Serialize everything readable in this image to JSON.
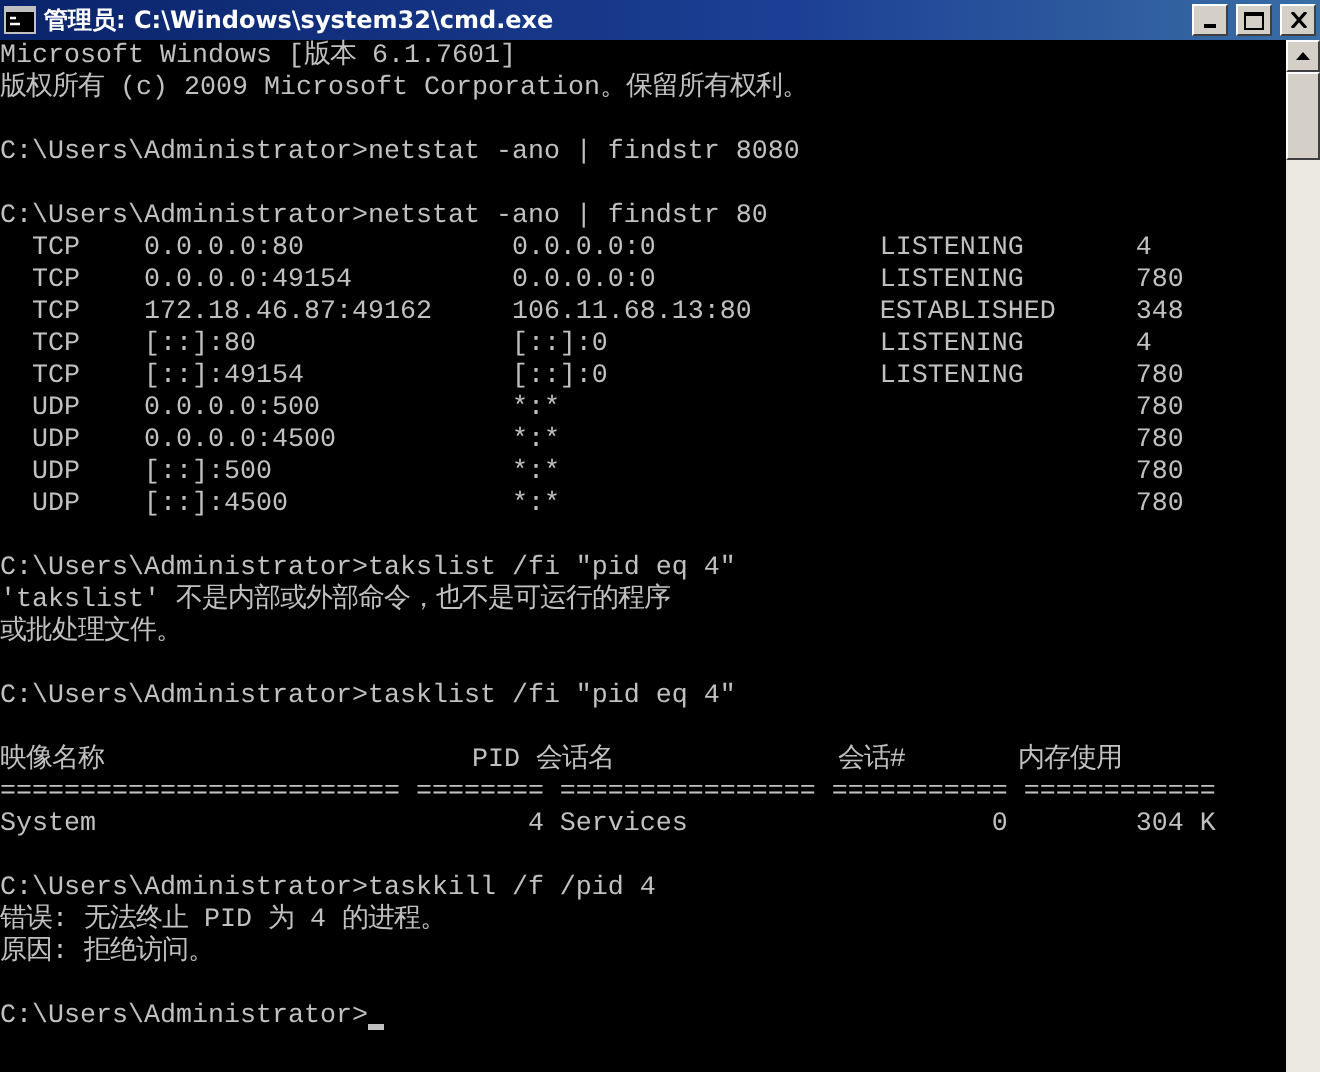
{
  "window": {
    "title": "管理员: C:\\Windows\\system32\\cmd.exe"
  },
  "console": {
    "cursor": true,
    "lines": [
      {
        "kind": "output",
        "text": "Microsoft Windows [版本 6.1.7601]"
      },
      {
        "kind": "output",
        "text": "版权所有 (c) 2009 Microsoft Corporation。保留所有权利。"
      },
      {
        "kind": "blank"
      },
      {
        "kind": "command",
        "text": "C:\\Users\\Administrator>netstat -ano | findstr 8080"
      },
      {
        "kind": "blank"
      },
      {
        "kind": "command",
        "text": "C:\\Users\\Administrator>netstat -ano | findstr 80"
      },
      {
        "kind": "output",
        "text": "  TCP    0.0.0.0:80             0.0.0.0:0              LISTENING       4"
      },
      {
        "kind": "output",
        "text": "  TCP    0.0.0.0:49154          0.0.0.0:0              LISTENING       780"
      },
      {
        "kind": "output",
        "text": "  TCP    172.18.46.87:49162     106.11.68.13:80        ESTABLISHED     348"
      },
      {
        "kind": "output",
        "text": "  TCP    [::]:80                [::]:0                 LISTENING       4"
      },
      {
        "kind": "output",
        "text": "  TCP    [::]:49154             [::]:0                 LISTENING       780"
      },
      {
        "kind": "output",
        "text": "  UDP    0.0.0.0:500            *:*                                    780"
      },
      {
        "kind": "output",
        "text": "  UDP    0.0.0.0:4500           *:*                                    780"
      },
      {
        "kind": "output",
        "text": "  UDP    [::]:500               *:*                                    780"
      },
      {
        "kind": "output",
        "text": "  UDP    [::]:4500              *:*                                    780"
      },
      {
        "kind": "blank"
      },
      {
        "kind": "command",
        "text": "C:\\Users\\Administrator>takslist /fi \"pid eq 4\""
      },
      {
        "kind": "output",
        "text": "'takslist' 不是内部或外部命令，也不是可运行的程序"
      },
      {
        "kind": "output",
        "text": "或批处理文件。"
      },
      {
        "kind": "blank"
      },
      {
        "kind": "command",
        "text": "C:\\Users\\Administrator>tasklist /fi \"pid eq 4\""
      },
      {
        "kind": "blank"
      },
      {
        "kind": "output",
        "text": "映像名称                       PID 会话名              会话#       内存使用"
      },
      {
        "kind": "output",
        "text": "========================= ======== ================ =========== ============"
      },
      {
        "kind": "output",
        "text": "System                           4 Services                   0        304 K"
      },
      {
        "kind": "blank"
      },
      {
        "kind": "command",
        "text": "C:\\Users\\Administrator>taskkill /f /pid 4"
      },
      {
        "kind": "output",
        "text": "错误: 无法终止 PID 为 4 的进程。"
      },
      {
        "kind": "output",
        "text": "原因: 拒绝访问。"
      },
      {
        "kind": "blank"
      },
      {
        "kind": "command",
        "text": "C:\\Users\\Administrator>"
      }
    ]
  }
}
